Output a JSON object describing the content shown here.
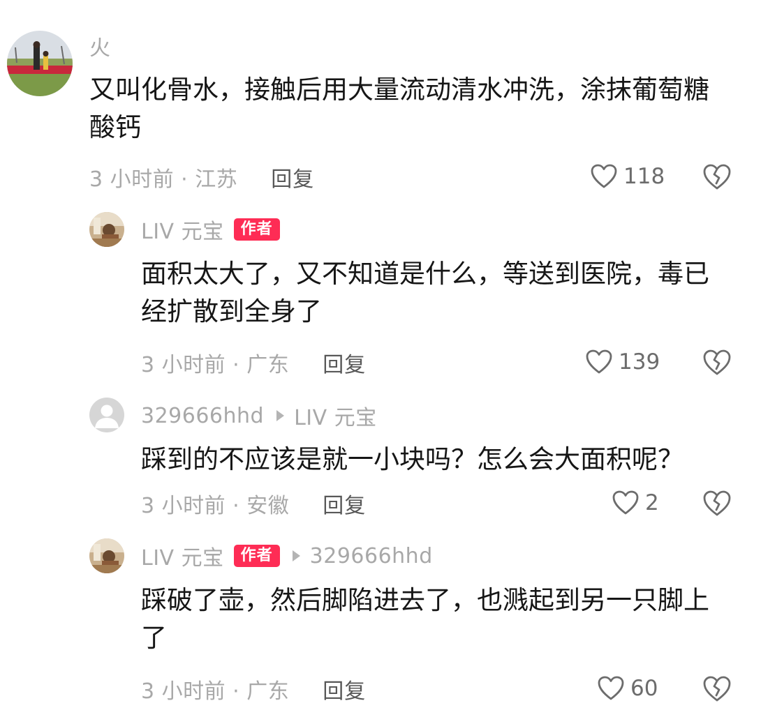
{
  "comments": [
    {
      "username": "火",
      "text": "又叫化骨水，接触后用大量流动清水冲洗，涂抹葡萄糖酸钙",
      "time_location": "3 小时前 · 江苏",
      "reply_label": "回复",
      "likes": "118"
    },
    {
      "username": "LIV 元宝",
      "badge": "作者",
      "text": "面积太大了，又不知道是什么，等送到医院，毒已经扩散到全身了",
      "time_location": "3 小时前 · 广东",
      "reply_label": "回复",
      "likes": "139"
    },
    {
      "username": "329666hhd",
      "reply_to": "LIV 元宝",
      "text": "踩到的不应该是就一小块吗？怎么会大面积呢？",
      "time_location": "3 小时前 · 安徽",
      "reply_label": "回复",
      "likes": "2"
    },
    {
      "username": "LIV 元宝",
      "badge": "作者",
      "reply_to": "329666hhd",
      "text": "踩破了壶，然后脚陷进去了，也溅起到另一只脚上了",
      "time_location": "3 小时前 · 广东",
      "reply_label": "回复",
      "likes": "60"
    }
  ],
  "icons": {
    "like": "heart-outline-icon",
    "dislike": "broken-heart-icon",
    "reply_arrow": "triangle-right-icon"
  },
  "colors": {
    "badge": "#fe2c55",
    "muted_text": "#a8a8a8",
    "body_text": "#161616"
  }
}
